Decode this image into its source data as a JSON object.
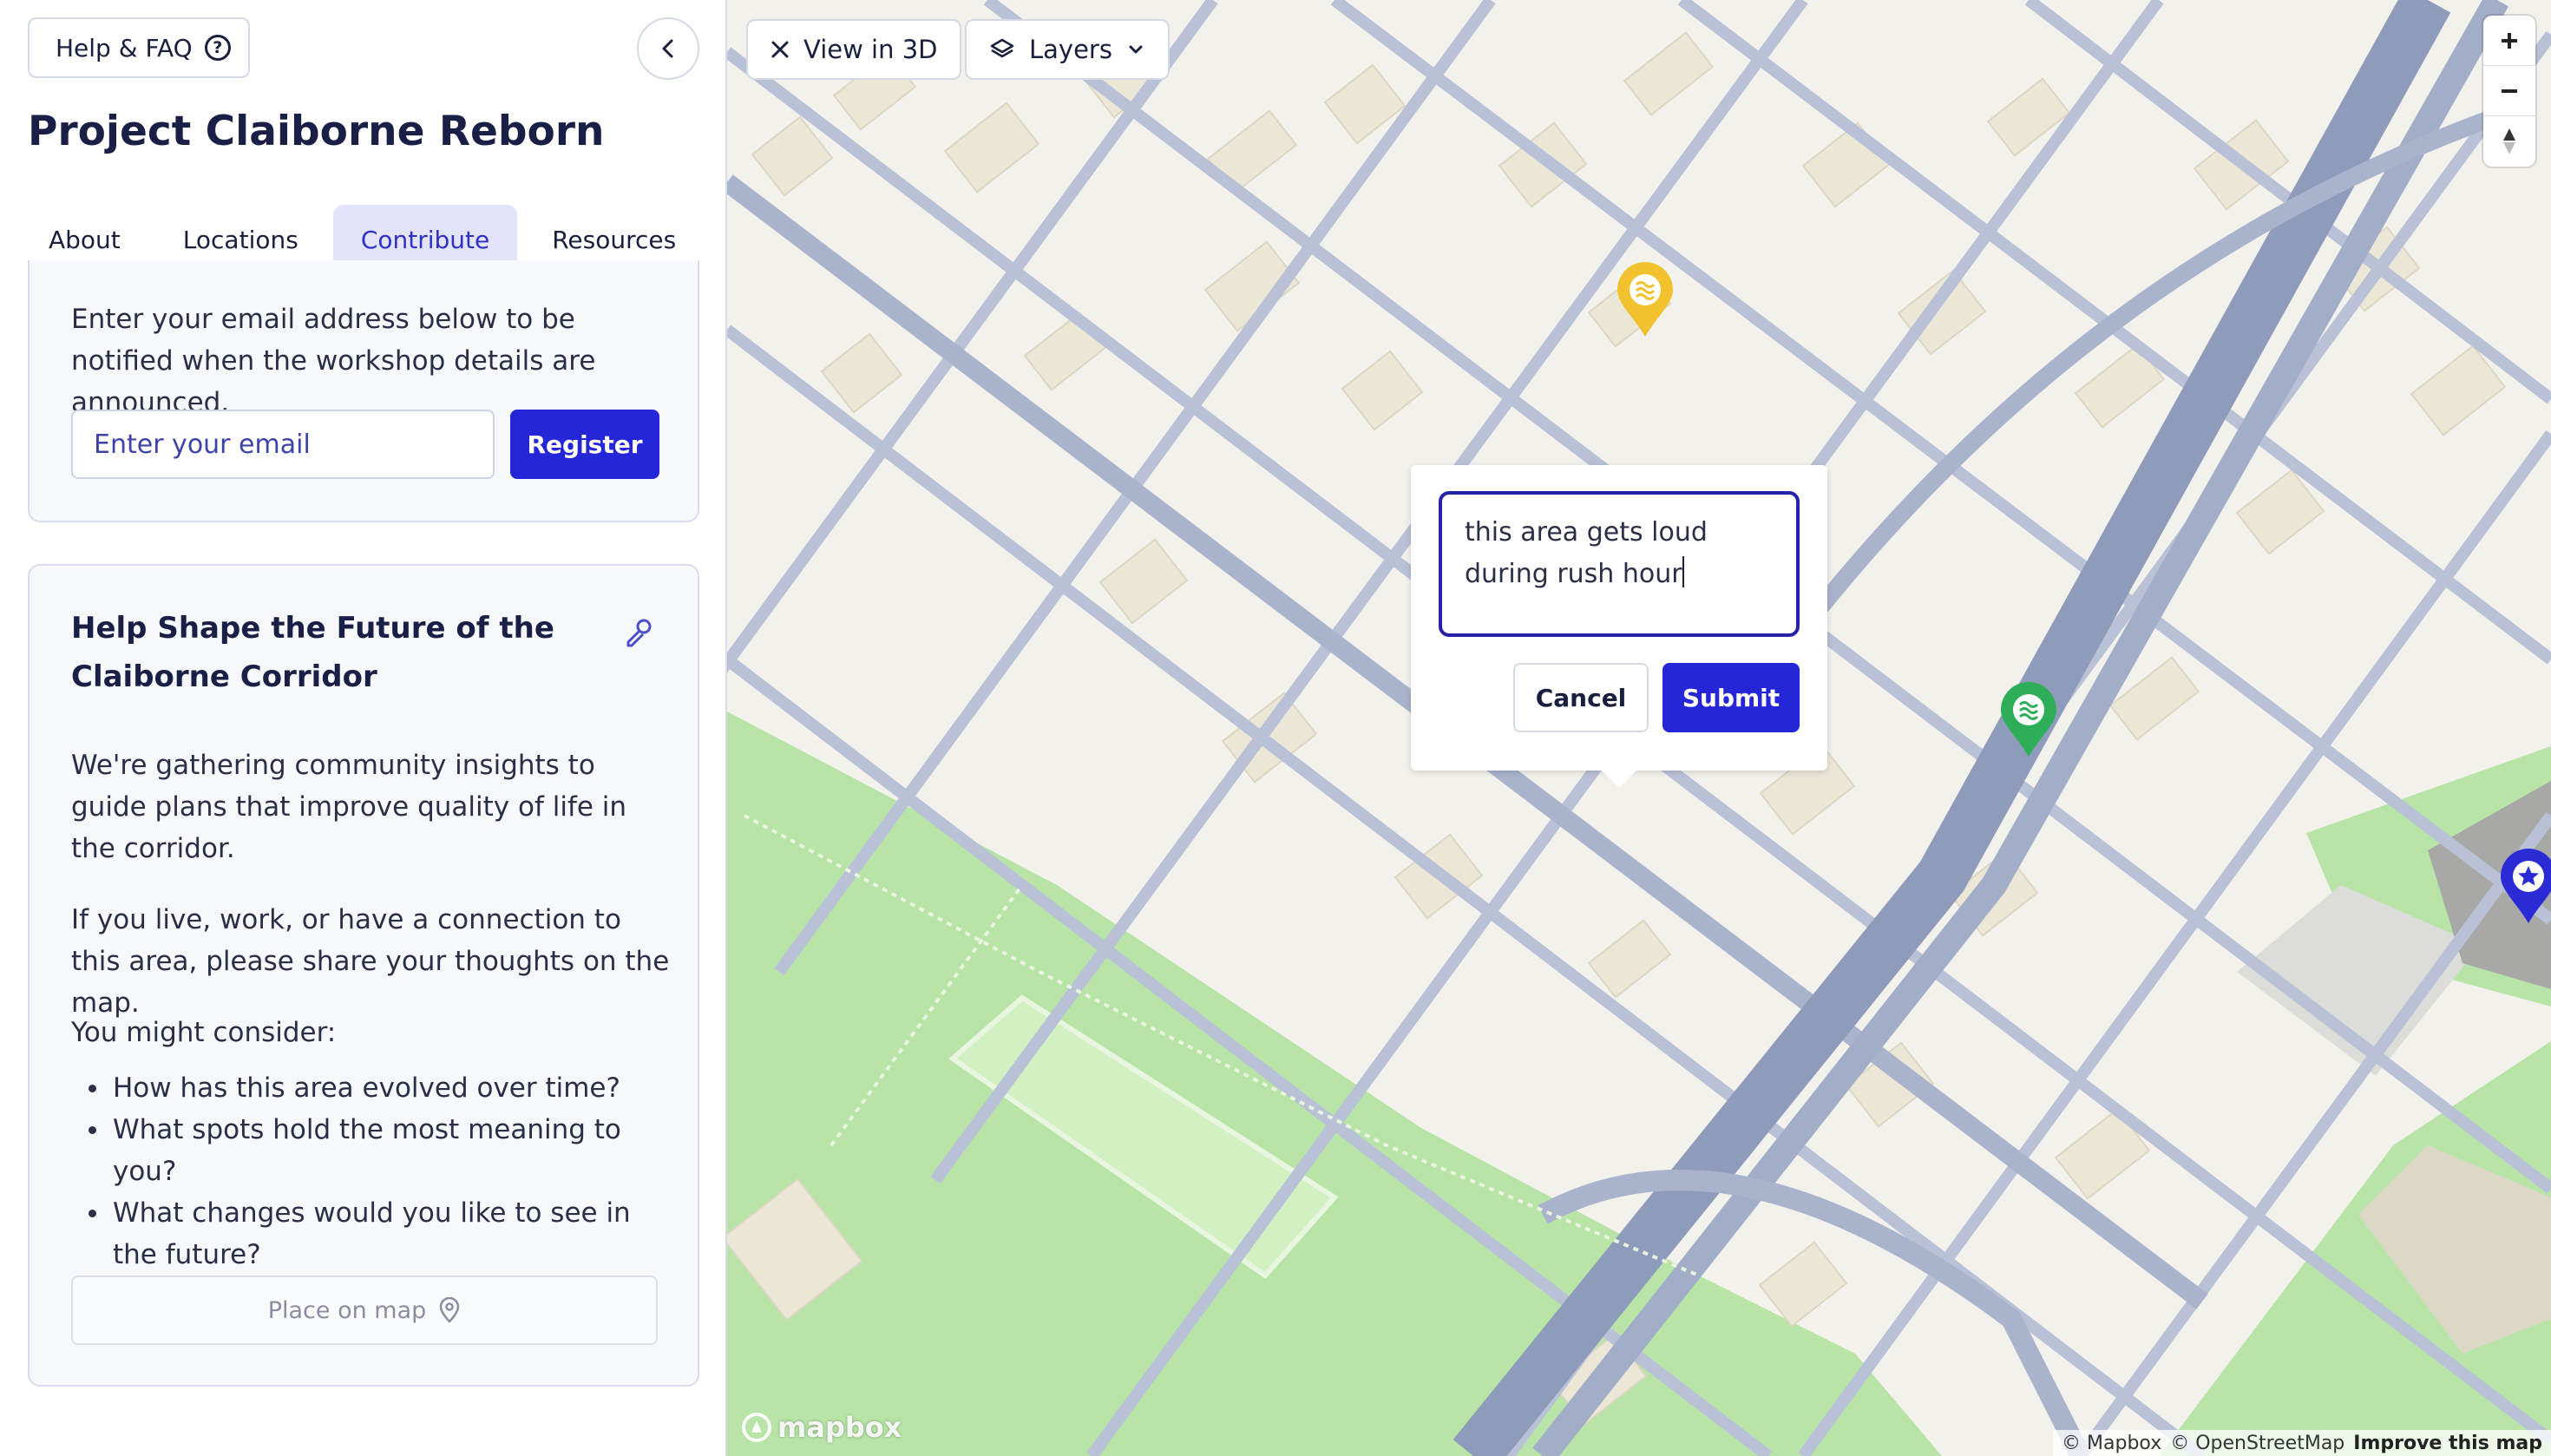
{
  "sidebar": {
    "help_label": "Help & FAQ",
    "title": "Project Claiborne Reborn",
    "tabs": [
      {
        "label": "About"
      },
      {
        "label": "Locations"
      },
      {
        "label": "Contribute",
        "active": true
      },
      {
        "label": "Resources"
      }
    ],
    "notify_card": {
      "description": "Enter your email address below to be notified when the workshop details are announced.",
      "email_placeholder": "Enter your email",
      "register_label": "Register"
    },
    "contribute_card": {
      "heading": "Help Shape the Future of the Claiborne Corridor",
      "paragraph1": "We're gathering community insights to guide plans that improve quality of life in the corridor.",
      "paragraph2": "If you live, work, or have a connection to this area, please share your thoughts on the map.",
      "consider_label": "You might consider:",
      "questions": [
        "How has this area evolved over time?",
        "What spots hold the most meaning to you?",
        "What changes would you like to see in the future?"
      ],
      "place_on_map_label": "Place on map"
    }
  },
  "map": {
    "view_3d_label": "View in 3D",
    "layers_label": "Layers",
    "popup": {
      "comment_line1": "this area gets loud",
      "comment_line2": "during rush hour",
      "cancel_label": "Cancel",
      "submit_label": "Submit"
    },
    "markers": [
      {
        "name": "yellow-water-marker",
        "color": "#f2c12e"
      },
      {
        "name": "green-water-marker",
        "color": "#2fae5a"
      },
      {
        "name": "blue-star-marker",
        "color": "#2b2bd6"
      }
    ],
    "logo_text": "mapbox",
    "attribution": {
      "mapbox": "© Mapbox",
      "osm": "© OpenStreetMap",
      "improve": "Improve this map"
    }
  },
  "colors": {
    "accent": "#2626d9",
    "accent_tint": "#e3e4fb",
    "title_navy": "#1a1f45",
    "park_green": "#b9e4a8",
    "road": "#b9c1d6",
    "building": "#ebe6d6"
  }
}
